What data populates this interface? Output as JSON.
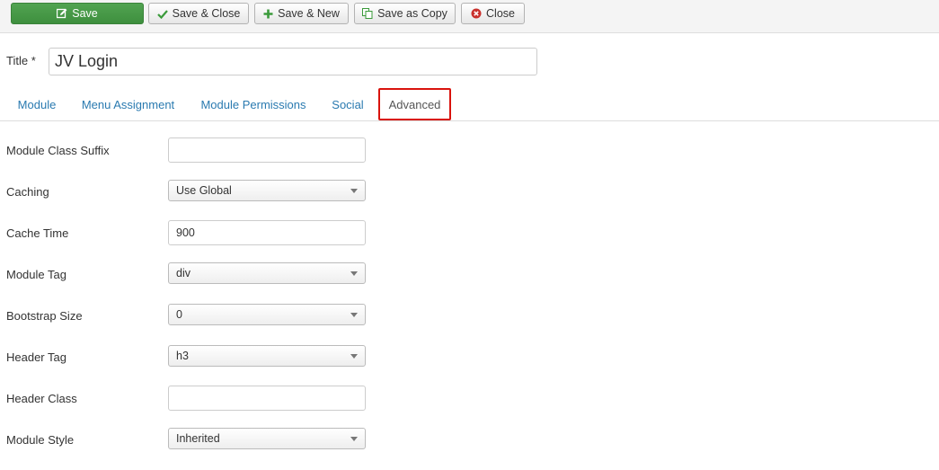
{
  "toolbar": {
    "save": {
      "label": "Save",
      "icon": "edit-icon"
    },
    "save_close": {
      "label": "Save & Close",
      "icon": "check-icon"
    },
    "save_new": {
      "label": "Save & New",
      "icon": "plus-icon"
    },
    "save_copy": {
      "label": "Save as Copy",
      "icon": "copy-icon"
    },
    "close": {
      "label": "Close",
      "icon": "close-icon"
    }
  },
  "title": {
    "label": "Title *",
    "value": "JV Login"
  },
  "tabs": [
    {
      "label": "Module"
    },
    {
      "label": "Menu Assignment"
    },
    {
      "label": "Module Permissions"
    },
    {
      "label": "Social"
    },
    {
      "label": "Advanced",
      "active": true
    }
  ],
  "fields": {
    "module_class_suffix": {
      "label": "Module Class Suffix",
      "value": ""
    },
    "caching": {
      "label": "Caching",
      "value": "Use Global"
    },
    "cache_time": {
      "label": "Cache Time",
      "value": "900"
    },
    "module_tag": {
      "label": "Module Tag",
      "value": "div"
    },
    "bootstrap_size": {
      "label": "Bootstrap Size",
      "value": "0"
    },
    "header_tag": {
      "label": "Header Tag",
      "value": "h3"
    },
    "header_class": {
      "label": "Header Class",
      "value": ""
    },
    "module_style": {
      "label": "Module Style",
      "value": "Inherited"
    }
  },
  "colors": {
    "save_green": "#48a148",
    "link_blue": "#2a7ab0",
    "active_tab_border": "#d9130d",
    "close_red": "#c9302c"
  }
}
